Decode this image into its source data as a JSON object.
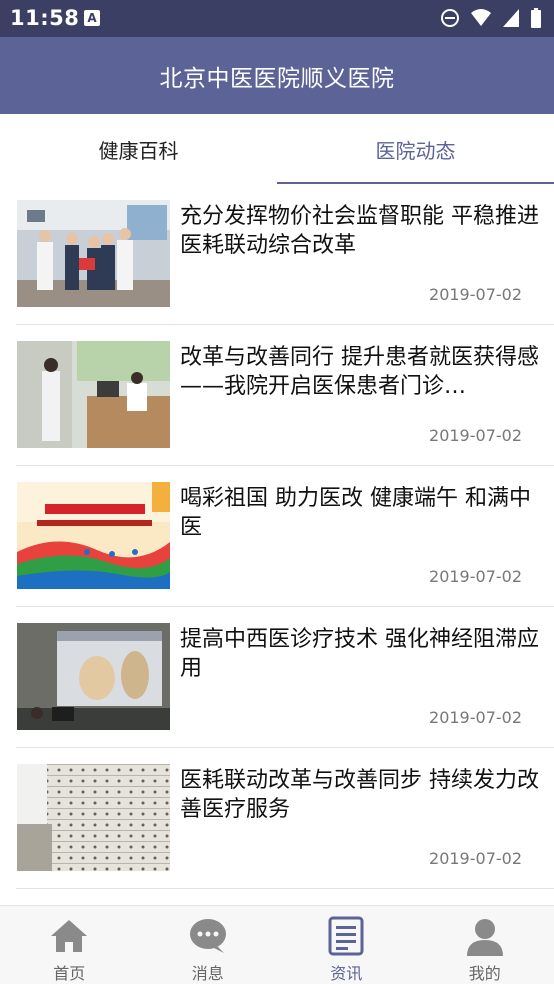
{
  "status_bar": {
    "time": "11:58",
    "a_icon": "A"
  },
  "app_bar": {
    "title": "北京中医医院顺义医院"
  },
  "tabs": [
    {
      "label": "健康百科",
      "active": false
    },
    {
      "label": "医院动态",
      "active": true
    }
  ],
  "news": [
    {
      "title": "充分发挥物价社会监督职能 平稳推进医耗联动综合改革",
      "date": "2019-07-02",
      "thumb": "award-ceremony-photo"
    },
    {
      "title": "改革与改善同行 提升患者就医获得感 ——我院开启医保患者门诊…",
      "date": "2019-07-02",
      "thumb": "clinic-office-photo"
    },
    {
      "title": "喝彩祖国 助力医改 健康端午 和满中医",
      "date": "2019-07-02",
      "thumb": "sports-event-banner"
    },
    {
      "title": "提高中西医诊疗技术 强化神经阻滞应用",
      "date": "2019-07-02",
      "thumb": "lecture-slides-photo"
    },
    {
      "title": "医耗联动改革与改善同步  持续发力改善医疗服务",
      "date": "2019-07-02",
      "thumb": "medicine-cabinet-photo"
    }
  ],
  "bottom_nav": [
    {
      "label": "首页",
      "icon": "home-icon",
      "active": false
    },
    {
      "label": "消息",
      "icon": "chat-icon",
      "active": false
    },
    {
      "label": "资讯",
      "icon": "news-icon",
      "active": true
    },
    {
      "label": "我的",
      "icon": "person-icon",
      "active": false
    }
  ],
  "colors": {
    "status_bar": "#3a3f63",
    "app_bar": "#5c6396",
    "accent": "#5c6396"
  }
}
